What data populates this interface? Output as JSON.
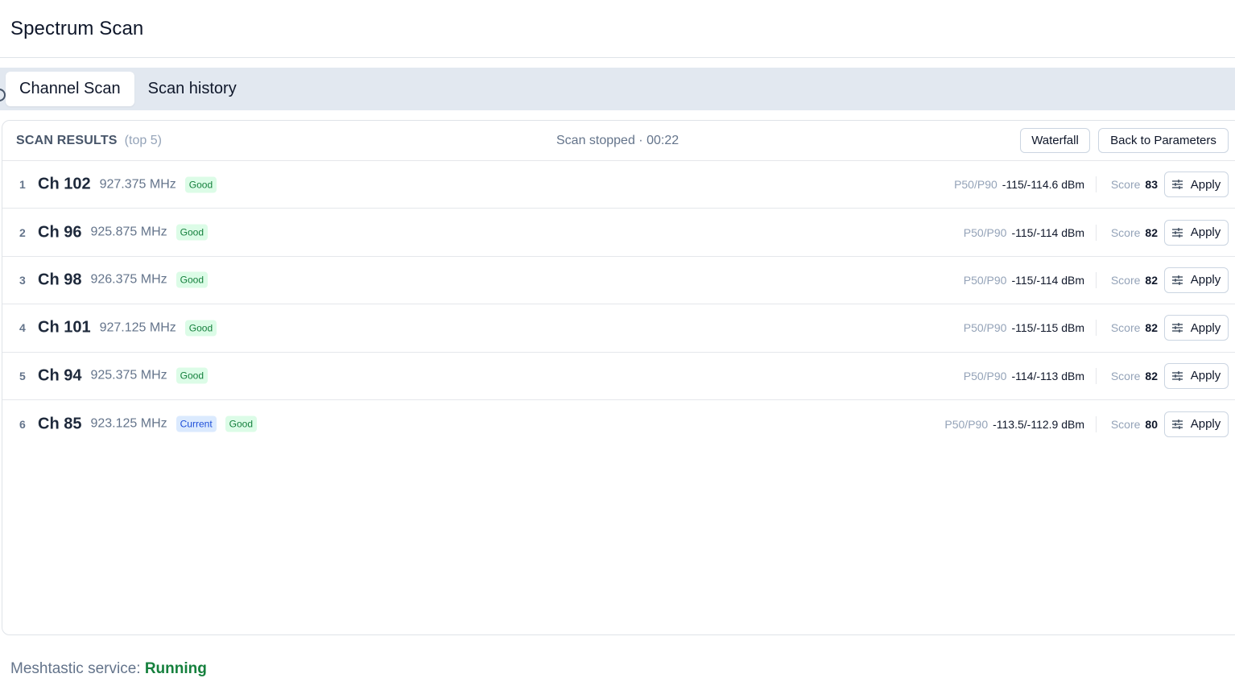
{
  "page": {
    "title": "Spectrum Scan"
  },
  "tabs": [
    {
      "label": "Channel Scan",
      "active": true
    },
    {
      "label": "Scan history",
      "active": false
    }
  ],
  "results": {
    "title": "SCAN RESULTS",
    "subtitle": "(top 5)",
    "status": "Scan stopped · 00:22",
    "waterfall_label": "Waterfall",
    "back_label": "Back to Parameters",
    "metric_label": "P50/P90",
    "score_label": "Score",
    "apply_label": "Apply",
    "rows": [
      {
        "rank": "1",
        "channel": "Ch 102",
        "freq": "927.375 MHz",
        "badges": [
          "Good"
        ],
        "p50p90": "-115/-114.6 dBm",
        "score": "83"
      },
      {
        "rank": "2",
        "channel": "Ch 96",
        "freq": "925.875 MHz",
        "badges": [
          "Good"
        ],
        "p50p90": "-115/-114 dBm",
        "score": "82"
      },
      {
        "rank": "3",
        "channel": "Ch 98",
        "freq": "926.375 MHz",
        "badges": [
          "Good"
        ],
        "p50p90": "-115/-114 dBm",
        "score": "82"
      },
      {
        "rank": "4",
        "channel": "Ch 101",
        "freq": "927.125 MHz",
        "badges": [
          "Good"
        ],
        "p50p90": "-115/-115 dBm",
        "score": "82"
      },
      {
        "rank": "5",
        "channel": "Ch 94",
        "freq": "925.375 MHz",
        "badges": [
          "Good"
        ],
        "p50p90": "-114/-113 dBm",
        "score": "82"
      },
      {
        "rank": "6",
        "channel": "Ch 85",
        "freq": "923.125 MHz",
        "badges": [
          "Current",
          "Good"
        ],
        "p50p90": "-113.5/-112.9 dBm",
        "score": "80"
      }
    ]
  },
  "service": {
    "label": "Meshtastic service:",
    "status": "Running"
  },
  "icons": {
    "apply": "sliders-icon"
  },
  "colors": {
    "good": "#15803d",
    "current": "#1d4ed8",
    "running": "#15803d"
  }
}
